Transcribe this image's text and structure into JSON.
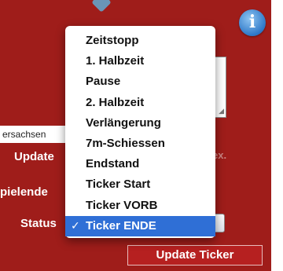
{
  "panel": {
    "region_text": "ersachsen",
    "update_label": "Update",
    "spielende_label": "pielende",
    "status_label": "Status",
    "faded_text": "ach ex.",
    "update_ticker_button": "Update Ticker",
    "info_icon_glyph": "i",
    "resize_glyph": "◢"
  },
  "status_dropdown": {
    "selected_index": 9,
    "check_glyph": "✓",
    "options": [
      "Zeitstopp",
      "1. Halbzeit",
      "Pause",
      "2. Halbzeit",
      "Verlängerung",
      "7m-Schiessen",
      "Endstand",
      "Ticker Start",
      "Ticker VORB",
      "Ticker ENDE"
    ]
  },
  "colors": {
    "panel_bg": "#9f1d1a",
    "selection": "#2f6fd6",
    "info_button": "#2e78c8"
  }
}
